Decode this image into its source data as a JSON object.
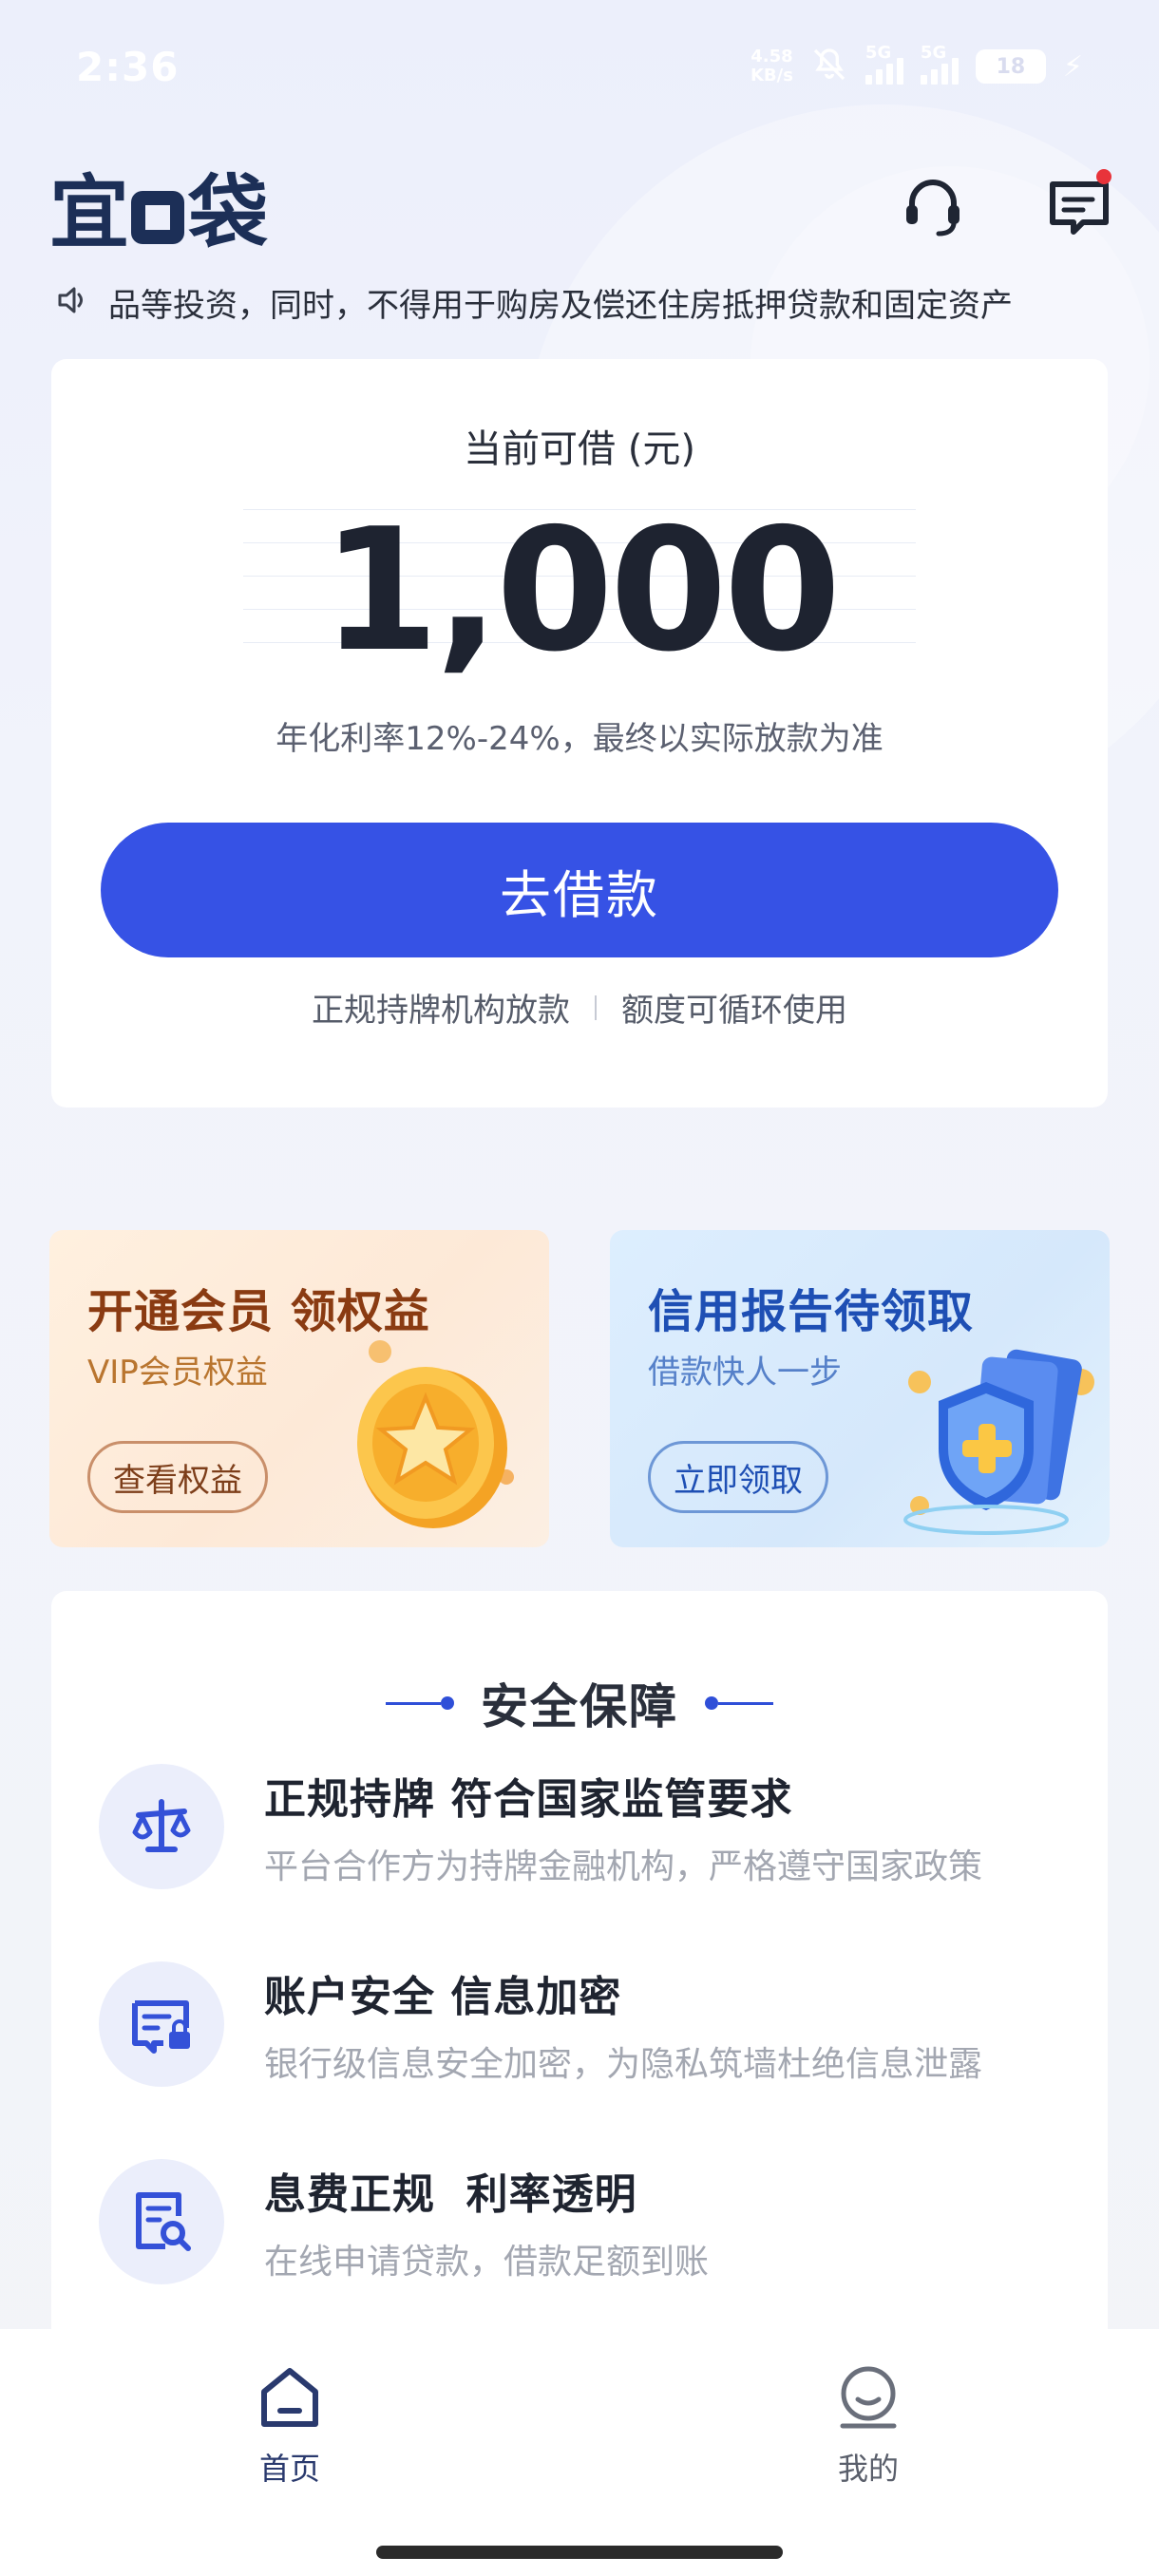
{
  "status_bar": {
    "time": "2:36",
    "net_speed_value": "4.58",
    "net_speed_unit": "KB/s",
    "network_1": "5G",
    "network_2": "5G",
    "battery": "18"
  },
  "header": {
    "logo_part1": "宜",
    "logo_part2": "袋",
    "message_has_unread": true
  },
  "notice": {
    "text": "品等投资，同时，不得用于购房及偿还住房抵押贷款和固定资产"
  },
  "loan_card": {
    "title": "当前可借 (元)",
    "amount": "1,000",
    "rate_note": "年化利率12%-24%，最终以实际放款为准",
    "borrow_button": "去借款",
    "tag_1": "正规持牌机构放款",
    "tag_2": "额度可循环使用"
  },
  "promos": {
    "vip": {
      "title": "开通会员 领权益",
      "subtitle": "VIP会员权益",
      "button": "查看权益"
    },
    "report": {
      "title": "信用报告待领取",
      "subtitle": "借款快人一步",
      "button": "立即领取"
    }
  },
  "security": {
    "title": "安全保障",
    "items": [
      {
        "icon": "scale-icon",
        "title": "正规持牌 符合国家监管要求",
        "desc": "平台合作方为持牌金融机构，严格遵守国家政策"
      },
      {
        "icon": "shield-card-icon",
        "title": "账户安全 信息加密",
        "desc": "银行级信息安全加密，为隐私筑墙杜绝信息泄露"
      },
      {
        "icon": "document-search-icon",
        "title": "息费正规  利率透明",
        "desc": "在线申请贷款，借款足额到账"
      }
    ]
  },
  "bottom_nav": {
    "home": "首页",
    "mine": "我的"
  },
  "colors": {
    "primary": "#3652e5",
    "logo": "#1c2f57",
    "unread_dot": "#e8333a"
  }
}
